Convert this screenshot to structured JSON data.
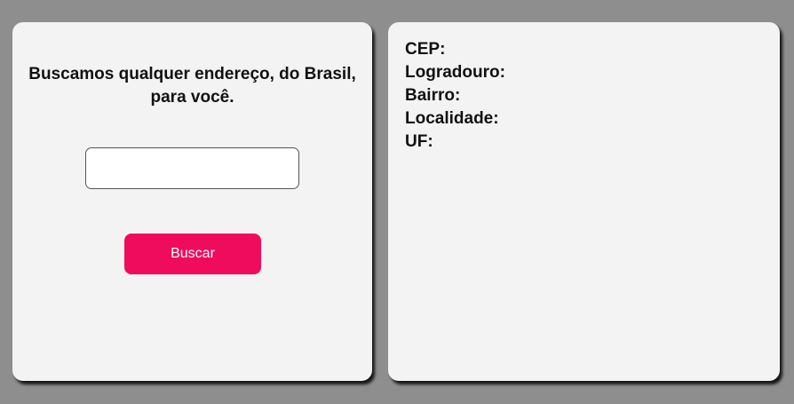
{
  "search": {
    "headline": "Buscamos qualquer endereço, do Brasil, para você.",
    "input_value": "",
    "input_placeholder": "",
    "button_label": "Buscar"
  },
  "result": {
    "fields": [
      {
        "label": "CEP:",
        "value": ""
      },
      {
        "label": "Logradouro:",
        "value": ""
      },
      {
        "label": "Bairro:",
        "value": ""
      },
      {
        "label": "Localidade:",
        "value": ""
      },
      {
        "label": "UF:",
        "value": ""
      }
    ]
  },
  "colors": {
    "background": "#8e8e8e",
    "card": "#f3f3f3",
    "accent": "#f00c5d",
    "text": "#111111"
  }
}
